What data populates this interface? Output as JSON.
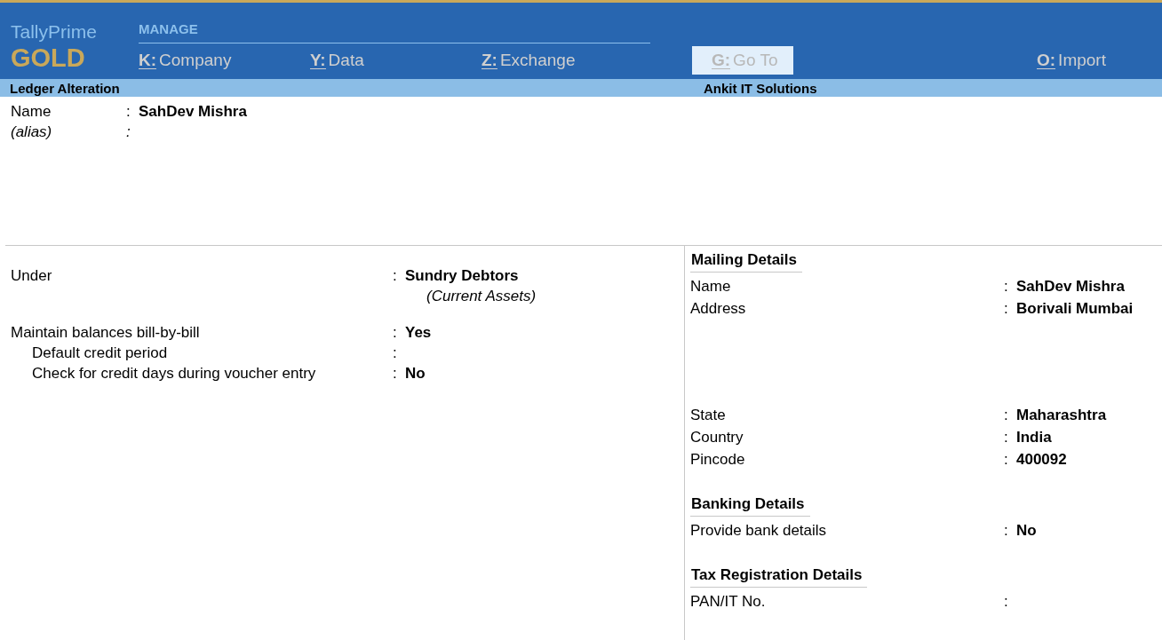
{
  "header": {
    "product": "TallyPrime",
    "edition": "GOLD",
    "menu_title": "MANAGE",
    "menu": [
      {
        "key": "K:",
        "label": "Company",
        "selected": false
      },
      {
        "key": "Y:",
        "label": "Data",
        "selected": false
      },
      {
        "key": "Z:",
        "label": "Exchange",
        "selected": false
      },
      {
        "key": "G:",
        "label": "Go To",
        "selected": true
      },
      {
        "key": "O:",
        "label": "Import",
        "selected": false
      }
    ]
  },
  "title_bar": {
    "title": "Ledger Alteration",
    "company": "Ankit IT Solutions"
  },
  "top_fields": [
    {
      "label": "Name",
      "sep": ":",
      "value": "SahDev Mishra",
      "kind": "field"
    },
    {
      "label": "(alias)",
      "sep": ":",
      "kind": "alias"
    }
  ],
  "left_fields": [
    {
      "label": "Under",
      "sep": ":",
      "value": "Sundry Debtors",
      "note": "(Current Assets)"
    },
    {
      "label": "Maintain balances bill-by-bill",
      "sep": ":",
      "value": "Yes",
      "children": [
        {
          "label": "Default credit period",
          "sep": ":"
        },
        {
          "label": "Check for credit days during voucher entry",
          "sep": ":",
          "value": "No"
        }
      ]
    }
  ],
  "right_sections": [
    {
      "title": "Mailing Details",
      "fields": [
        {
          "label": "Name",
          "sep": ":",
          "value": "SahDev Mishra",
          "kind": "field"
        },
        {
          "label": "Address",
          "sep": ":",
          "value": "Borivali Mumbai",
          "kind": "address"
        },
        {
          "label": "State",
          "sep": ":",
          "value": "Maharashtra",
          "kind": "field"
        },
        {
          "label": "Country",
          "sep": ":",
          "value": "India",
          "kind": "field"
        },
        {
          "label": "Pincode",
          "sep": ":",
          "value": "400092",
          "kind": "field"
        }
      ]
    },
    {
      "title": "Banking Details",
      "fields": [
        {
          "label": "Provide bank details",
          "sep": ":",
          "value": "No",
          "kind": "field"
        }
      ]
    },
    {
      "title": "Tax Registration Details",
      "fields": [
        {
          "label": "PAN/IT No.",
          "sep": ":",
          "kind": "field"
        }
      ]
    }
  ]
}
